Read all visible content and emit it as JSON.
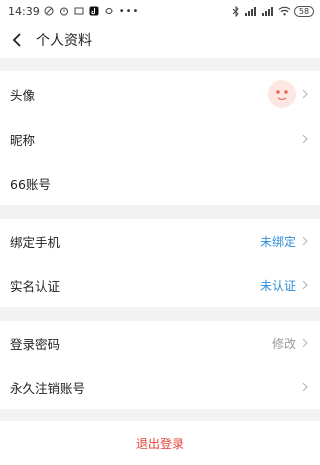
{
  "status_bar": {
    "time": "14:39",
    "battery": "58"
  },
  "header": {
    "title": "个人资料"
  },
  "profile": {
    "avatar_label": "头像",
    "nickname_label": "昵称",
    "account_label": "66账号"
  },
  "binding": {
    "phone_label": "绑定手机",
    "phone_value": "未绑定",
    "realname_label": "实名认证",
    "realname_value": "未认证"
  },
  "security": {
    "password_label": "登录密码",
    "password_value": "修改",
    "cancel_label": "永久注销账号"
  },
  "logout_label": "退出登录",
  "colors": {
    "accent_blue": "#2f8fd8",
    "logout_red": "#e0443a",
    "background": "#f3f3f3"
  }
}
